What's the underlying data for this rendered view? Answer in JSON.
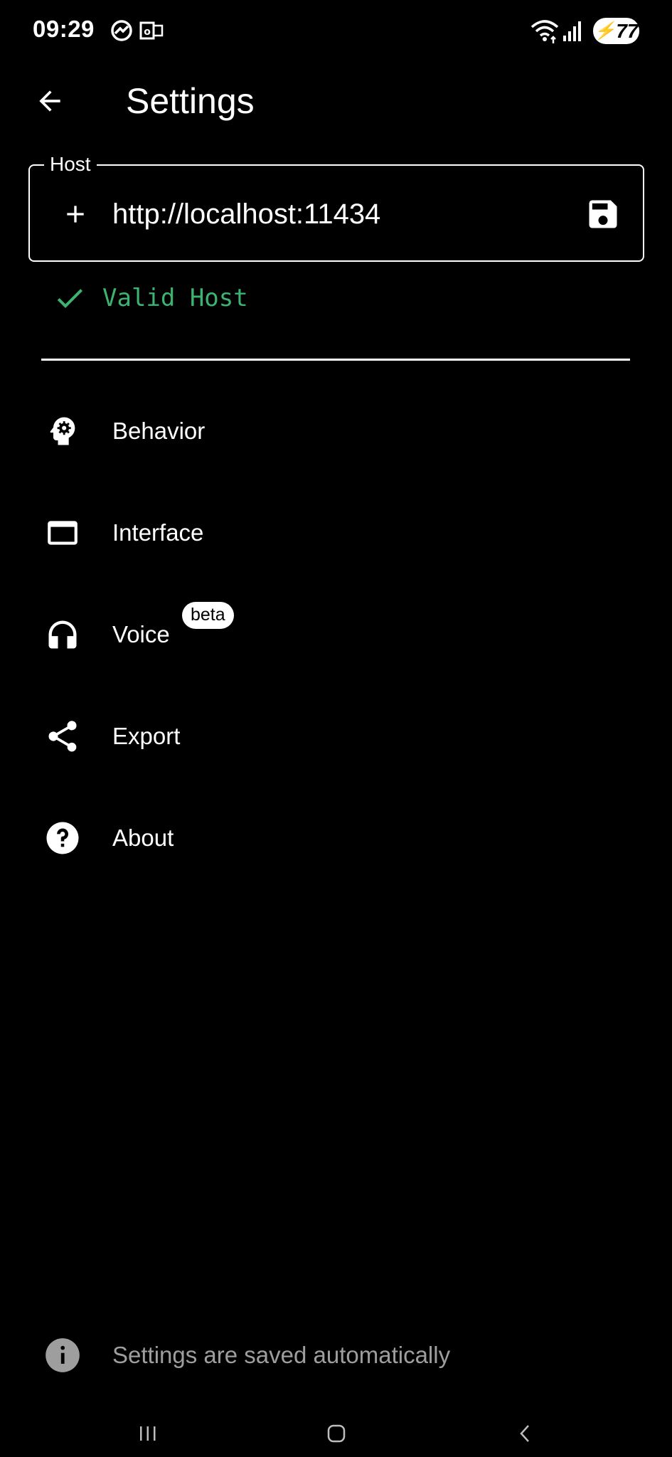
{
  "status_bar": {
    "time": "09:29",
    "battery": "77",
    "icons": [
      "messenger-icon",
      "outlook-icon",
      "wifi-icon",
      "signal-icon",
      "battery-charging-icon"
    ]
  },
  "app_bar": {
    "title": "Settings",
    "back_icon": "arrow-back-icon"
  },
  "host": {
    "label": "Host",
    "value": "http://localhost:11434",
    "add_icon": "plus-icon",
    "save_icon": "save-icon",
    "status_text": "Valid Host",
    "status_icon": "check-icon",
    "status_color": "#3cb371"
  },
  "menu": {
    "items": [
      {
        "label": "Behavior",
        "icon": "psychology-icon"
      },
      {
        "label": "Interface",
        "icon": "window-icon"
      },
      {
        "label": "Voice",
        "icon": "headphones-icon",
        "badge": "beta"
      },
      {
        "label": "Export",
        "icon": "share-icon"
      },
      {
        "label": "About",
        "icon": "help-icon"
      }
    ]
  },
  "footer": {
    "text": "Settings are saved automatically",
    "icon": "info-icon"
  },
  "colors": {
    "background": "#000000",
    "foreground": "#ffffff",
    "muted": "#9e9e9e",
    "success": "#3cb371"
  }
}
